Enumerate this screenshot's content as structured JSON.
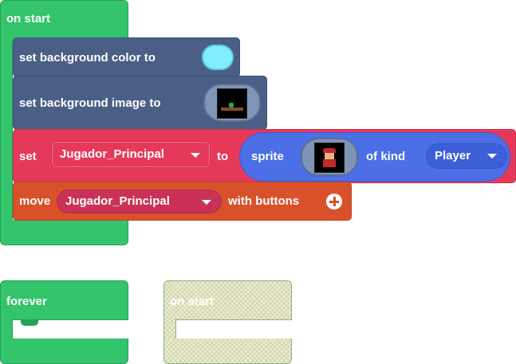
{
  "on_start": {
    "label": "on start",
    "blocks": {
      "bg_color": {
        "label": "set background color to",
        "color": "#80eeff"
      },
      "bg_image": {
        "label": "set background image to"
      },
      "set_sprite": {
        "label_set": "set",
        "variable": "Jugador_Principal",
        "label_to": "to",
        "label_sprite": "sprite",
        "label_of_kind": "of kind",
        "kind": "Player"
      },
      "move": {
        "label": "move",
        "variable": "Jugador_Principal",
        "label_with": "with buttons",
        "add_icon": "plus-circle-icon"
      }
    }
  },
  "forever": {
    "label": "forever"
  },
  "on_start_disabled": {
    "label": "on start"
  },
  "colors": {
    "event_green": "#33c46c",
    "scene_slate": "#4b5f86",
    "sprite_red": "#e6395a",
    "sprite_blue": "#4c6ee6",
    "controller_orange": "#d9512a"
  }
}
